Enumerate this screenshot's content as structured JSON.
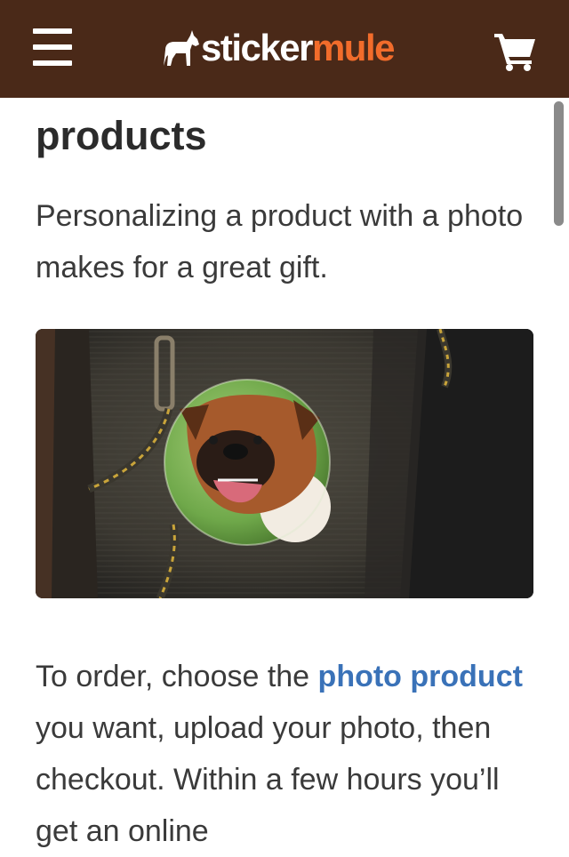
{
  "header": {
    "logo_primary": "sticker",
    "logo_accent": "mule",
    "menu_icon": "hamburger-menu-icon",
    "cart_icon": "shopping-cart-icon",
    "background_color": "#4a2918",
    "accent_color": "#f26c2b"
  },
  "main": {
    "heading": "products",
    "intro": "Personalizing a product with a photo makes for a great gift.",
    "image_description": "Photo button with boxer dog pinned to backpack",
    "body_before_link": "To order, choose the ",
    "link_text": "photo product",
    "body_after_link": " you want, upload your photo, then checkout. Within a few hours you’ll get an online",
    "link_color": "#3a72b8"
  }
}
